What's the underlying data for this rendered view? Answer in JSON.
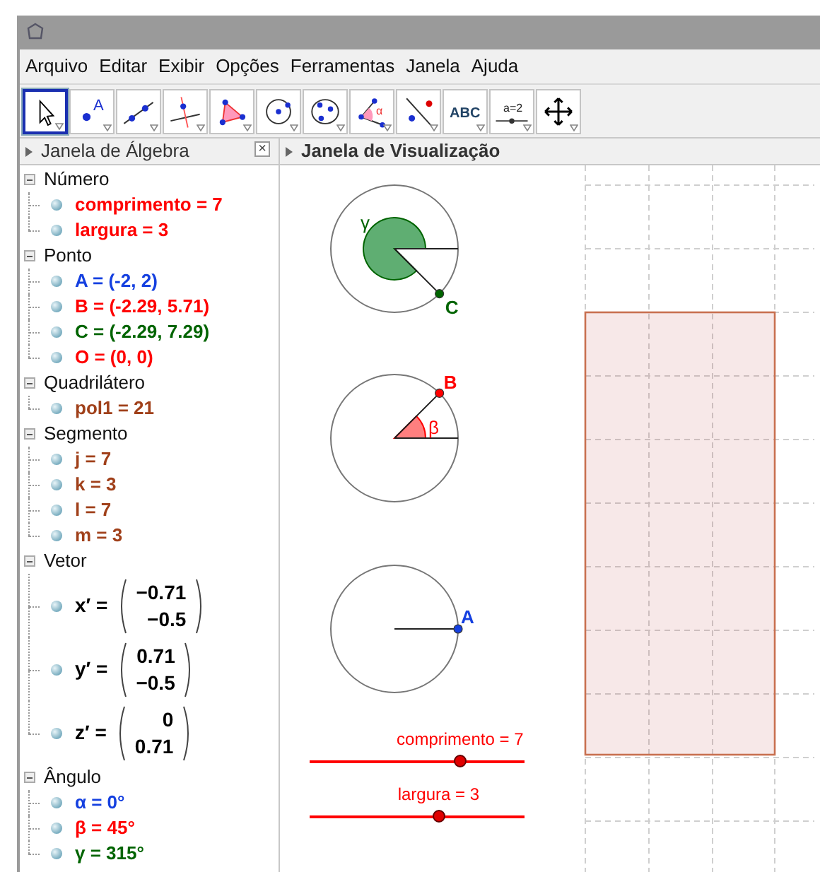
{
  "menu": [
    "Arquivo",
    "Editar",
    "Exibir",
    "Opções",
    "Ferramentas",
    "Janela",
    "Ajuda"
  ],
  "toolbar": [
    {
      "kind": "pointer",
      "selected": true
    },
    {
      "kind": "point",
      "label": "A",
      "selected": false
    },
    {
      "kind": "line",
      "selected": false
    },
    {
      "kind": "perpendicular",
      "selected": false
    },
    {
      "kind": "polygon",
      "selected": false
    },
    {
      "kind": "circle",
      "selected": false
    },
    {
      "kind": "circle3",
      "selected": false
    },
    {
      "kind": "angle",
      "label": "α",
      "selected": false
    },
    {
      "kind": "reflect",
      "selected": false
    },
    {
      "kind": "text",
      "label": "ABC",
      "selected": false
    },
    {
      "kind": "slider",
      "label": "a=2",
      "selected": false
    },
    {
      "kind": "move",
      "selected": false
    }
  ],
  "algebra": {
    "title": "Janela de Álgebra",
    "close": "×",
    "groups": [
      {
        "label": "Número",
        "expanded": true,
        "items": [
          {
            "kind": "text",
            "text": "comprimento = 7",
            "color": "#ff0000"
          },
          {
            "kind": "text",
            "text": "largura = 3",
            "color": "#ff0000"
          }
        ]
      },
      {
        "label": "Ponto",
        "expanded": true,
        "items": [
          {
            "kind": "text",
            "text": "A = (-2, 2)",
            "color": "#1540e0"
          },
          {
            "kind": "text",
            "text": "B = (-2.29, 5.71)",
            "color": "#ff0000"
          },
          {
            "kind": "text",
            "text": "C = (-2.29, 7.29)",
            "color": "#006400"
          },
          {
            "kind": "text",
            "text": "O = (0, 0)",
            "color": "#ff0000"
          }
        ]
      },
      {
        "label": "Quadrilátero",
        "expanded": true,
        "items": [
          {
            "kind": "text",
            "text": "pol1 = 21",
            "color": "#a0401a"
          }
        ]
      },
      {
        "label": "Segmento",
        "expanded": true,
        "items": [
          {
            "kind": "text",
            "text": "j = 7",
            "color": "#a0401a"
          },
          {
            "kind": "text",
            "text": "k = 3",
            "color": "#a0401a"
          },
          {
            "kind": "text",
            "text": "l = 7",
            "color": "#a0401a"
          },
          {
            "kind": "text",
            "text": "m = 3",
            "color": "#a0401a"
          }
        ]
      },
      {
        "label": "Vetor",
        "expanded": true,
        "items": [
          {
            "kind": "vector",
            "text": "x′ =",
            "components": [
              "−0.71",
              "−0.5"
            ],
            "color": "#000000"
          },
          {
            "kind": "vector",
            "text": "y′ =",
            "components": [
              "0.71",
              "−0.5"
            ],
            "color": "#000000"
          },
          {
            "kind": "vector",
            "text": "z′ =",
            "components": [
              "0",
              "0.71"
            ],
            "color": "#000000"
          }
        ]
      },
      {
        "label": "Ângulo",
        "expanded": true,
        "items": [
          {
            "kind": "text",
            "text": "α = 0°",
            "color": "#1540e0"
          },
          {
            "kind": "text",
            "text": "β = 45°",
            "color": "#ff0000"
          },
          {
            "kind": "text",
            "text": "γ = 315°",
            "color": "#006400"
          }
        ]
      }
    ]
  },
  "graphics": {
    "title": "Janela de Visualização",
    "figures": [
      {
        "kind": "reflex-angle",
        "angle_label": "γ",
        "point_label": "C",
        "color": "#006400"
      },
      {
        "kind": "angle",
        "angle_label": "β",
        "point_label": "B",
        "color": "#ff0000"
      },
      {
        "kind": "point",
        "point_label": "A",
        "color": "#1540e0"
      }
    ],
    "sliders": [
      {
        "label": "comprimento = 7",
        "level": 0.7
      },
      {
        "label": "largura = 3",
        "level": 0.6
      }
    ]
  }
}
